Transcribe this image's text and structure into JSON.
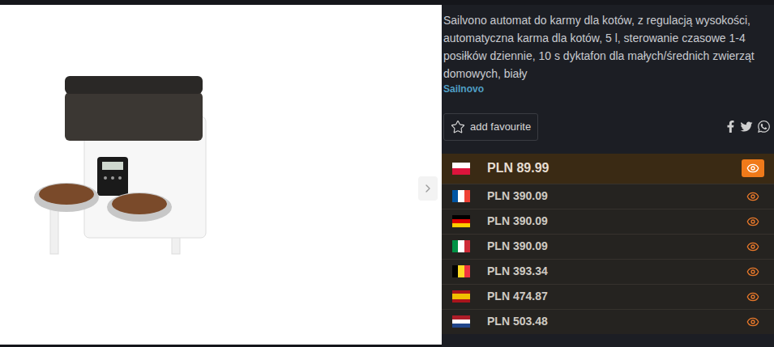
{
  "product": {
    "title": "Sailvono automat do karmy dla kotów, z regulacją wysokości, automatyczna karma dla kotów, 5 l, sterowanie czasowe 1-4 posiłków dziennie, 10 s dyktafon dla małych/średnich zwierząt domowych, biały",
    "brand": "Sailnovo"
  },
  "favourite_button": {
    "label": "add favourite"
  },
  "prices": [
    {
      "kind": "pl",
      "price": "PLN 89.99",
      "selected": true
    },
    {
      "kind": "fr",
      "price": "PLN 390.09",
      "selected": false
    },
    {
      "kind": "de",
      "price": "PLN 390.09",
      "selected": false
    },
    {
      "kind": "it",
      "price": "PLN 390.09",
      "selected": false
    },
    {
      "kind": "be",
      "price": "PLN 393.34",
      "selected": false
    },
    {
      "kind": "es",
      "price": "PLN 474.87",
      "selected": false
    },
    {
      "kind": "nl",
      "price": "PLN 503.48",
      "selected": false
    }
  ]
}
